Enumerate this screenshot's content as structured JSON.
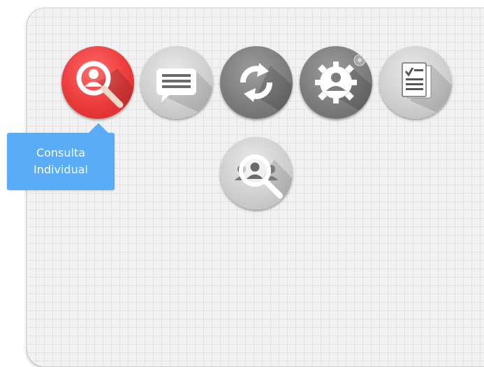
{
  "tooltip": {
    "text": "Consulta\nIndividual"
  },
  "colors": {
    "active_button": "#ec3b3b",
    "tooltip_bg": "#5aacf6",
    "panel_bg": "#f1f1f1"
  },
  "toolbar": {
    "buttons": [
      {
        "icon": "person-search-icon",
        "state": "active"
      },
      {
        "icon": "message-icon",
        "state": "normal"
      },
      {
        "icon": "refresh-icon",
        "state": "normal"
      },
      {
        "icon": "user-settings-icon",
        "state": "normal"
      },
      {
        "icon": "checklist-document-icon",
        "state": "normal"
      }
    ],
    "second_row": [
      {
        "icon": "group-search-icon",
        "state": "normal"
      }
    ]
  }
}
